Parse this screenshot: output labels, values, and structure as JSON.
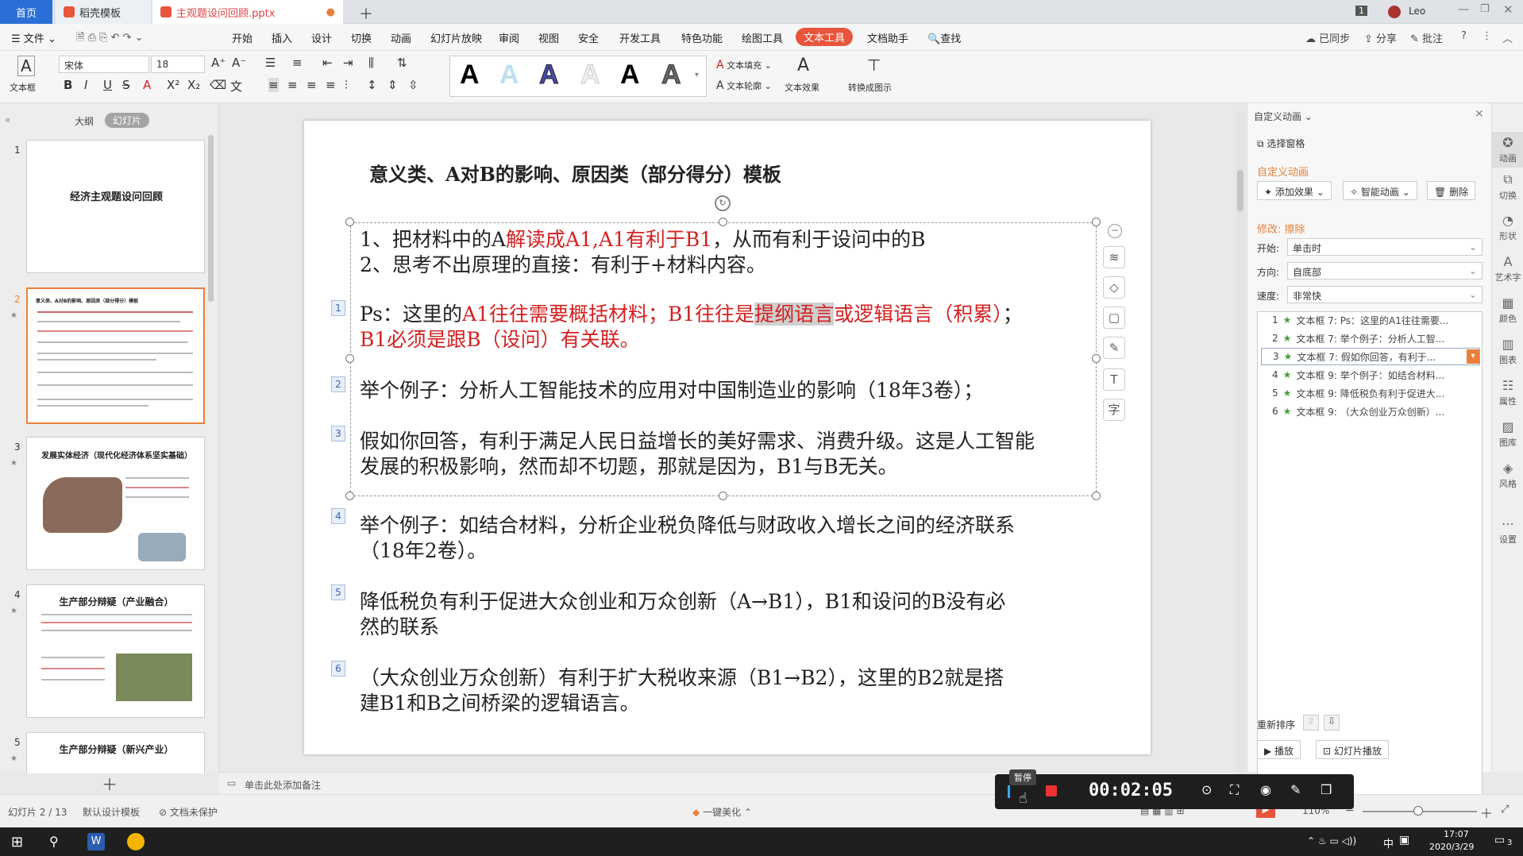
{
  "tabs": {
    "home": "首页",
    "template": "稻壳模板",
    "file": "主观题设问回顾.pptx"
  },
  "window": {
    "badge": "1",
    "user": "Leo"
  },
  "menu": {
    "file": "文件",
    "items": [
      "开始",
      "插入",
      "设计",
      "切换",
      "动画",
      "幻灯片放映",
      "审阅",
      "视图",
      "安全",
      "开发工具",
      "特色功能",
      "绘图工具",
      "文本工具",
      "文档助手"
    ],
    "search": "查找",
    "sync": "已同步",
    "share": "分享",
    "comment": "批注"
  },
  "ribbon": {
    "textbox": "文本框",
    "font_name": "宋体",
    "font_size": "18",
    "text_fill": "文本填充",
    "text_outline": "文本轮廓",
    "text_effect": "文本效果",
    "convert": "转换成图示"
  },
  "left_panel": {
    "tab_outline": "大纲",
    "tab_slides": "幻灯片",
    "slides": [
      {
        "num": "1",
        "title": "经济主观题设问回顾"
      },
      {
        "num": "2",
        "title": "意义类、A对B的影响、原因类（部分得分）模板"
      },
      {
        "num": "3",
        "title": "发展实体经济（现代化经济体系坚实基础）"
      },
      {
        "num": "4",
        "title": "生产部分辩疑（产业融合）"
      },
      {
        "num": "5",
        "title": "生产部分辩疑（新兴产业）"
      }
    ]
  },
  "slide": {
    "title": "意义类、A对B的影响、原因类（部分得分）模板",
    "line1": {
      "a": "1、把材料中的A",
      "b": "解读成A1,A1有利于B1",
      "c": "，从而有利于设问中的B"
    },
    "line2": "2、思考不出原理的直接：有利于+材料内容。",
    "ps": {
      "a": "Ps：这里的",
      "b": "A1往往需要概括材料；B1往往是",
      "c": "提纲语言",
      "d": "或逻辑语言（积累）",
      "e": "；",
      "f": "B1必须是跟B（设问）有关联。"
    },
    "ex1": "举个例子：分析人工智能技术的应用对中国制造业的影响（18年3卷）；",
    "ans1_l1": "假如你回答，有利于满足人民日益增长的美好需求、消费升级。这是人工智能",
    "ans1_l2": "发展的积极影响，然而却不切题，那就是因为，B1与B无关。",
    "ex2_l1": "举个例子：如结合材料，分析企业税负降低与财政收入增长之间的经济联系",
    "ex2_l2": "（18年2卷）。",
    "p5_l1": "降低税负有利于促进大众创业和万众创新（A→B1），B1和设问的B没有必",
    "p5_l2": "然的联系",
    "p6_l1": "（大众创业万众创新）有利于扩大税收来源（B1→B2），这里的B2就是搭",
    "p6_l2": "建B1和B之间桥梁的逻辑语言。",
    "badges": [
      "1",
      "2",
      "3",
      "4",
      "5",
      "6"
    ]
  },
  "notes_placeholder": "单击此处添加备注",
  "right_panel": {
    "title": "自定义动画",
    "select_pane": "选择窗格",
    "section": "自定义动画",
    "add_effect": "添加效果",
    "smart_anim": "智能动画",
    "delete": "删除",
    "modify": "修改: 擦除",
    "start_label": "开始:",
    "start_value": "单击时",
    "direction_label": "方向:",
    "direction_value": "自底部",
    "speed_label": "速度:",
    "speed_value": "非常快",
    "animations": [
      {
        "num": "1",
        "text": "文本框 7: Ps：这里的A1往往需要..."
      },
      {
        "num": "2",
        "text": "文本框 7: 举个例子：分析人工智..."
      },
      {
        "num": "3",
        "text": "文本框 7: 假如你回答，有利于..."
      },
      {
        "num": "4",
        "text": "文本框 9: 举个例子：如结合材料..."
      },
      {
        "num": "5",
        "text": "文本框 9: 降低税负有利于促进大..."
      },
      {
        "num": "6",
        "text": "文本框 9: （大众创业万众创新）..."
      }
    ],
    "reorder": "重新排序",
    "play": "播放",
    "slideshow": "幻灯片播放"
  },
  "right_bar": [
    "动画",
    "切换",
    "形状",
    "艺术字",
    "颜色",
    "图表",
    "属性",
    "图库",
    "风格",
    "设置"
  ],
  "status": {
    "slide": "幻灯片 2 / 13",
    "template": "默认设计模板",
    "protect": "文档未保护",
    "beautify": "一键美化",
    "zoom": "110%"
  },
  "recorder": {
    "pause_tip": "暂停",
    "time": "00:02:05"
  },
  "taskbar": {
    "time": "17:07",
    "date": "2020/3/29",
    "ime": "中",
    "notif": "3"
  },
  "colors": {
    "accent": "#e8553c",
    "red_text": "#d42020",
    "home_tab": "#2a6fd6"
  }
}
